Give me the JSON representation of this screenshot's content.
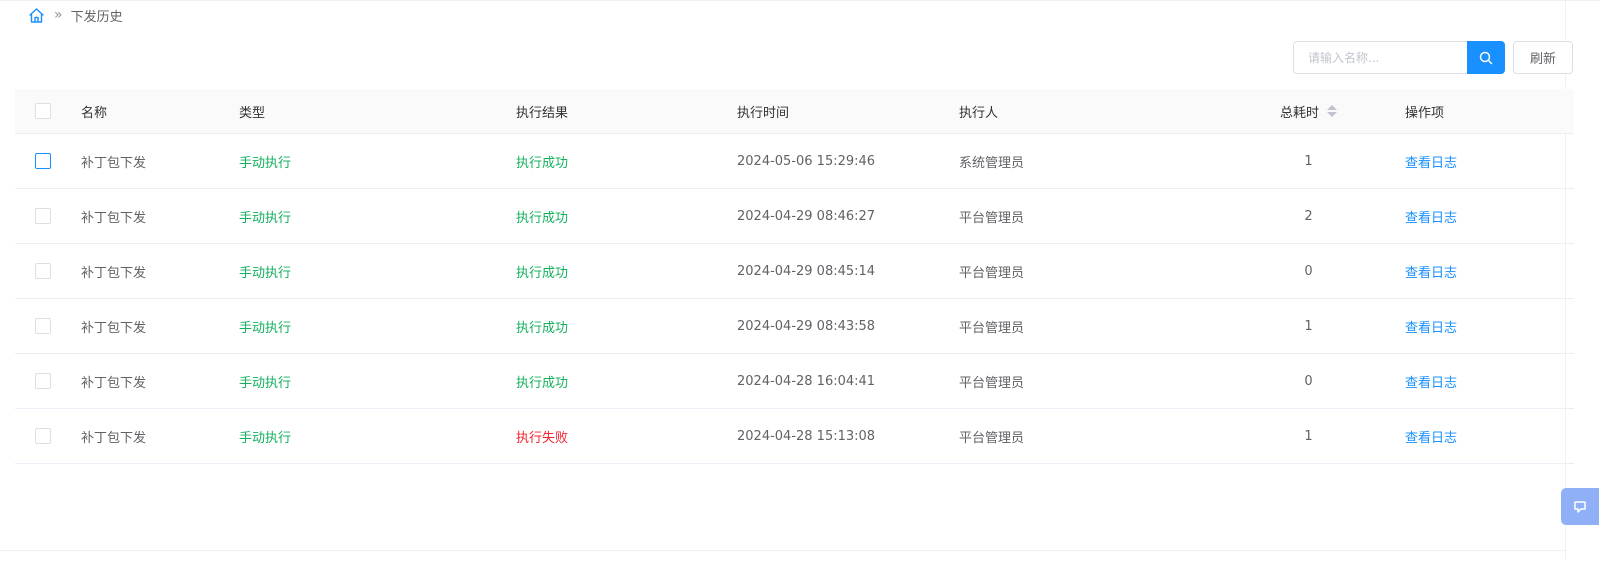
{
  "breadcrumb": {
    "separator": "»",
    "current": "下发历史"
  },
  "search": {
    "placeholder": "请输入名称..."
  },
  "toolbar": {
    "refresh_label": "刷新"
  },
  "table": {
    "columns": {
      "name": "名称",
      "type": "类型",
      "result": "执行结果",
      "time": "执行时间",
      "executor": "执行人",
      "cost": "总耗时",
      "actions": "操作项"
    },
    "rows": [
      {
        "name": "补丁包下发",
        "type": "手动执行",
        "result": "执行成功",
        "time": "2024-05-06 15:29:46",
        "executor": "系统管理员",
        "cost": "1",
        "action": "查看日志"
      },
      {
        "name": "补丁包下发",
        "type": "手动执行",
        "result": "执行成功",
        "time": "2024-04-29 08:46:27",
        "executor": "平台管理员",
        "cost": "2",
        "action": "查看日志"
      },
      {
        "name": "补丁包下发",
        "type": "手动执行",
        "result": "执行成功",
        "time": "2024-04-29 08:45:14",
        "executor": "平台管理员",
        "cost": "0",
        "action": "查看日志"
      },
      {
        "name": "补丁包下发",
        "type": "手动执行",
        "result": "执行成功",
        "time": "2024-04-29 08:43:58",
        "executor": "平台管理员",
        "cost": "1",
        "action": "查看日志"
      },
      {
        "name": "补丁包下发",
        "type": "手动执行",
        "result": "执行成功",
        "time": "2024-04-28 16:04:41",
        "executor": "平台管理员",
        "cost": "0",
        "action": "查看日志"
      },
      {
        "name": "补丁包下发",
        "type": "手动执行",
        "result": "执行失败",
        "time": "2024-04-28 15:13:08",
        "executor": "平台管理员",
        "cost": "1",
        "action": "查看日志"
      }
    ]
  },
  "colors": {
    "accent": "#1890ff",
    "success": "#13b05e",
    "failure": "#f5222d"
  },
  "icons": {
    "home": "home-icon",
    "search": "search-icon",
    "sort": "sort-icon",
    "float": "feedback-icon"
  }
}
